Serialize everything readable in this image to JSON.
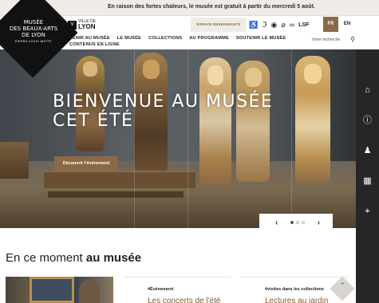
{
  "announcement": "En raison des fortes chaleurs, le musée est gratuit à partir du mercredi 5 août.",
  "logo": {
    "line1": "MUSÉE",
    "line2": "DES BEAUX-ARTS",
    "line3": "DE LYON",
    "line4": "PIERRE-LOUIS WATTÉ"
  },
  "ville": {
    "small": "VILLE DE",
    "big": "LYON",
    "mark": "V"
  },
  "nav": [
    "VENIR AU MUSÉE",
    "LE MUSÉE",
    "COLLECTIONS",
    "AU PROGRAMME",
    "SOUTENIR LE MUSÉE",
    "CONTENUS EN LIGNE"
  ],
  "espace": "ESPACE ENSEIGNANTS",
  "accessibility": [
    "wheelchair-icon",
    "hearing-icon",
    "vision-icon",
    "low-vision-icon",
    "loop-icon"
  ],
  "lsf": "LSF",
  "lang": {
    "fr": "FR",
    "en": "EN"
  },
  "search": {
    "placeholder": "Votre recherche"
  },
  "hero": {
    "title_line1": "BIENVENUE AU MUSÉE",
    "title_line2": "CET ÉTÉ",
    "cta": "Découvrir l'événement",
    "slide_count": 3,
    "active_slide": 1
  },
  "rail_icons": [
    "museum-icon",
    "info-icon",
    "family-icon",
    "calendar-icon",
    "location-icon"
  ],
  "section": {
    "title_light": "En ce moment",
    "title_bold": "au musée"
  },
  "cards": [
    {
      "tag": "#Événement",
      "title": "Les concerts de l'été"
    },
    {
      "tag": "#visites dans les collections",
      "title": "Lectures au jardin"
    }
  ],
  "colors": {
    "accent": "#8a6a46",
    "rail": "#262626",
    "announce_bg": "#efece7"
  }
}
